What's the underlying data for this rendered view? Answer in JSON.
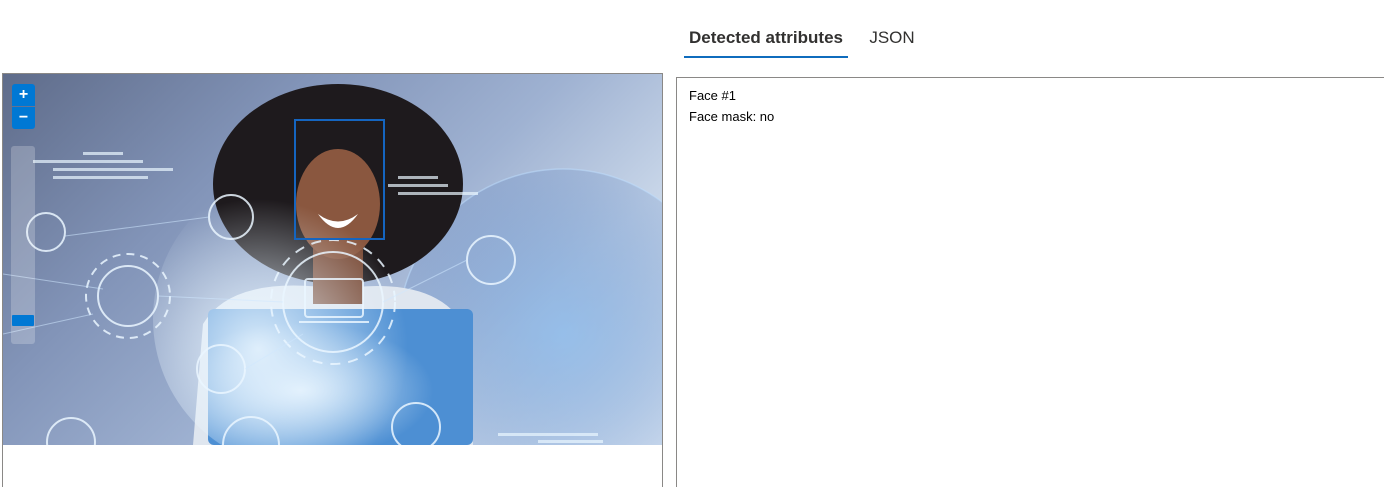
{
  "tabs": {
    "detected": "Detected attributes",
    "json": "JSON",
    "active": "detected"
  },
  "viewer": {
    "zoom_in_label": "+",
    "zoom_out_label": "−",
    "zoom_level": 0.05
  },
  "result": {
    "face_title": "Face #1",
    "face_mask": "Face mask: no"
  },
  "colors": {
    "accent": "#0078d4",
    "tab_underline": "#0f6cbd",
    "face_box": "#1565c0",
    "border": "#8a8886"
  }
}
